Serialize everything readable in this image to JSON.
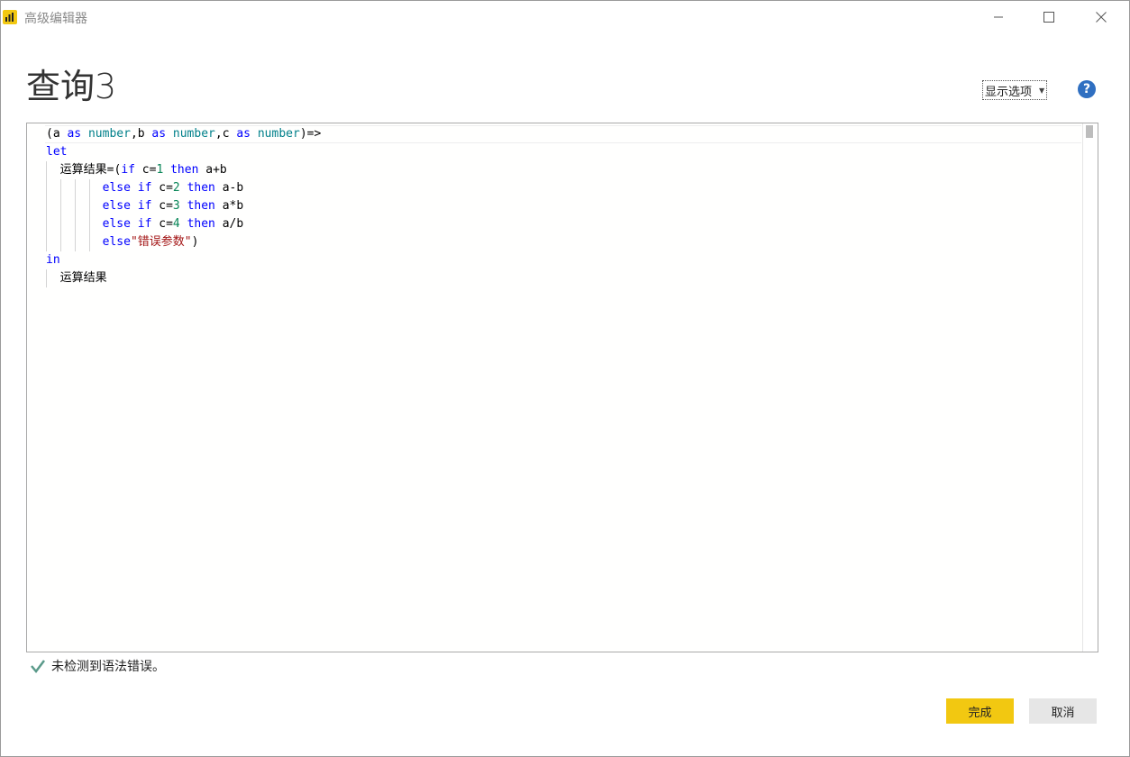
{
  "window": {
    "title": "高级编辑器"
  },
  "query": {
    "title": "查询3"
  },
  "toolbar": {
    "display_options": "显示选项",
    "help": "?"
  },
  "editor": {
    "lines": [
      [
        {
          "t": "(a ",
          "c": ""
        },
        {
          "t": "as",
          "c": "kw"
        },
        {
          "t": " ",
          "c": ""
        },
        {
          "t": "number",
          "c": "ty"
        },
        {
          "t": ",b ",
          "c": ""
        },
        {
          "t": "as",
          "c": "kw"
        },
        {
          "t": " ",
          "c": ""
        },
        {
          "t": "number",
          "c": "ty"
        },
        {
          "t": ",c ",
          "c": ""
        },
        {
          "t": "as",
          "c": "kw"
        },
        {
          "t": " ",
          "c": ""
        },
        {
          "t": "number",
          "c": "ty"
        },
        {
          "t": ")=>",
          "c": ""
        }
      ],
      [
        {
          "t": "let",
          "c": "kw"
        }
      ],
      [
        {
          "t": "  运算结果=(",
          "c": ""
        },
        {
          "t": "if",
          "c": "kw"
        },
        {
          "t": " c=",
          "c": ""
        },
        {
          "t": "1",
          "c": "num"
        },
        {
          "t": " ",
          "c": ""
        },
        {
          "t": "then",
          "c": "kw"
        },
        {
          "t": " a+b",
          "c": ""
        }
      ],
      [
        {
          "t": "        ",
          "c": ""
        },
        {
          "t": "else if",
          "c": "kw"
        },
        {
          "t": " c=",
          "c": ""
        },
        {
          "t": "2",
          "c": "num"
        },
        {
          "t": " ",
          "c": ""
        },
        {
          "t": "then",
          "c": "kw"
        },
        {
          "t": " a-b",
          "c": ""
        }
      ],
      [
        {
          "t": "        ",
          "c": ""
        },
        {
          "t": "else if",
          "c": "kw"
        },
        {
          "t": " c=",
          "c": ""
        },
        {
          "t": "3",
          "c": "num"
        },
        {
          "t": " ",
          "c": ""
        },
        {
          "t": "then",
          "c": "kw"
        },
        {
          "t": " a*b",
          "c": ""
        }
      ],
      [
        {
          "t": "        ",
          "c": ""
        },
        {
          "t": "else if",
          "c": "kw"
        },
        {
          "t": " c=",
          "c": ""
        },
        {
          "t": "4",
          "c": "num"
        },
        {
          "t": " ",
          "c": ""
        },
        {
          "t": "then",
          "c": "kw"
        },
        {
          "t": " a/b",
          "c": ""
        }
      ],
      [
        {
          "t": "        ",
          "c": ""
        },
        {
          "t": "else",
          "c": "kw"
        },
        {
          "t": "\"错误参数\"",
          "c": "str"
        },
        {
          "t": ")",
          "c": ""
        }
      ],
      [
        {
          "t": "in",
          "c": "kw"
        }
      ],
      [
        {
          "t": "  运算结果",
          "c": ""
        }
      ]
    ]
  },
  "status": {
    "message": "未检测到语法错误。"
  },
  "buttons": {
    "done": "完成",
    "cancel": "取消"
  },
  "colors": {
    "accent": "#f2c811",
    "keyword": "#0000ff",
    "type": "#00808a",
    "number": "#098658",
    "string": "#a31515",
    "check": "#5a9a8a"
  }
}
